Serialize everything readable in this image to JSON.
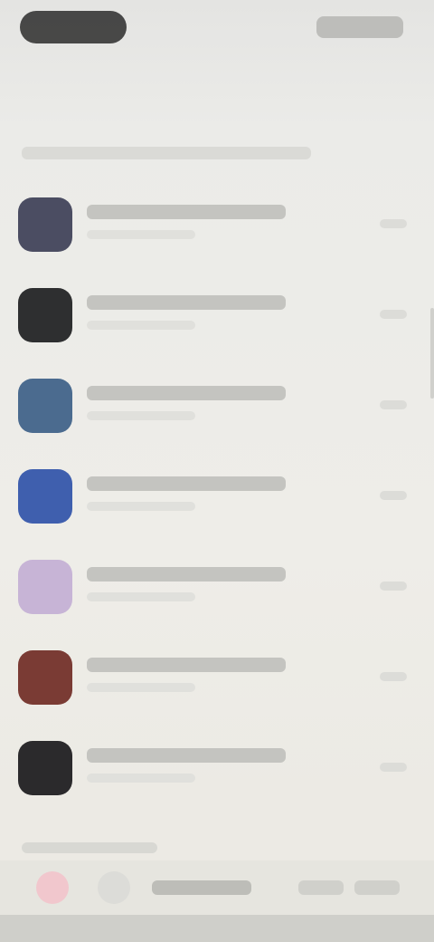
{
  "status_bar": {
    "carrier_pill_color": "#2c2c2c"
  },
  "header": {
    "title": ""
  },
  "section": {
    "title": "",
    "subtitle": ""
  },
  "list": {
    "items": [
      {
        "title": "",
        "subtitle": "",
        "meta": "",
        "icon": "app-icon-slate",
        "color": "#4b4d62"
      },
      {
        "title": "",
        "subtitle": "",
        "meta": "",
        "icon": "app-icon-dark",
        "color": "#2e2f30"
      },
      {
        "title": "",
        "subtitle": "",
        "meta": "",
        "icon": "app-icon-steel-blue",
        "color": "#4b6b8f"
      },
      {
        "title": "",
        "subtitle": "",
        "meta": "",
        "icon": "app-icon-blue",
        "color": "#3f5fae"
      },
      {
        "title": "",
        "subtitle": "",
        "meta": "",
        "icon": "app-icon-lavender",
        "color": "#c7b4d6"
      },
      {
        "title": "",
        "subtitle": "",
        "meta": "",
        "icon": "app-icon-rust",
        "color": "#7a3b34"
      },
      {
        "title": "",
        "subtitle": "",
        "meta": "",
        "icon": "app-icon-charcoal",
        "color": "#2b2a2c"
      }
    ]
  },
  "bottom_bar": {
    "label": "",
    "icons": [
      {
        "name": "pink-app-icon",
        "color": "#f1c7cd"
      },
      {
        "name": "grid-app-icon",
        "color": "#dcdcd8"
      }
    ]
  }
}
